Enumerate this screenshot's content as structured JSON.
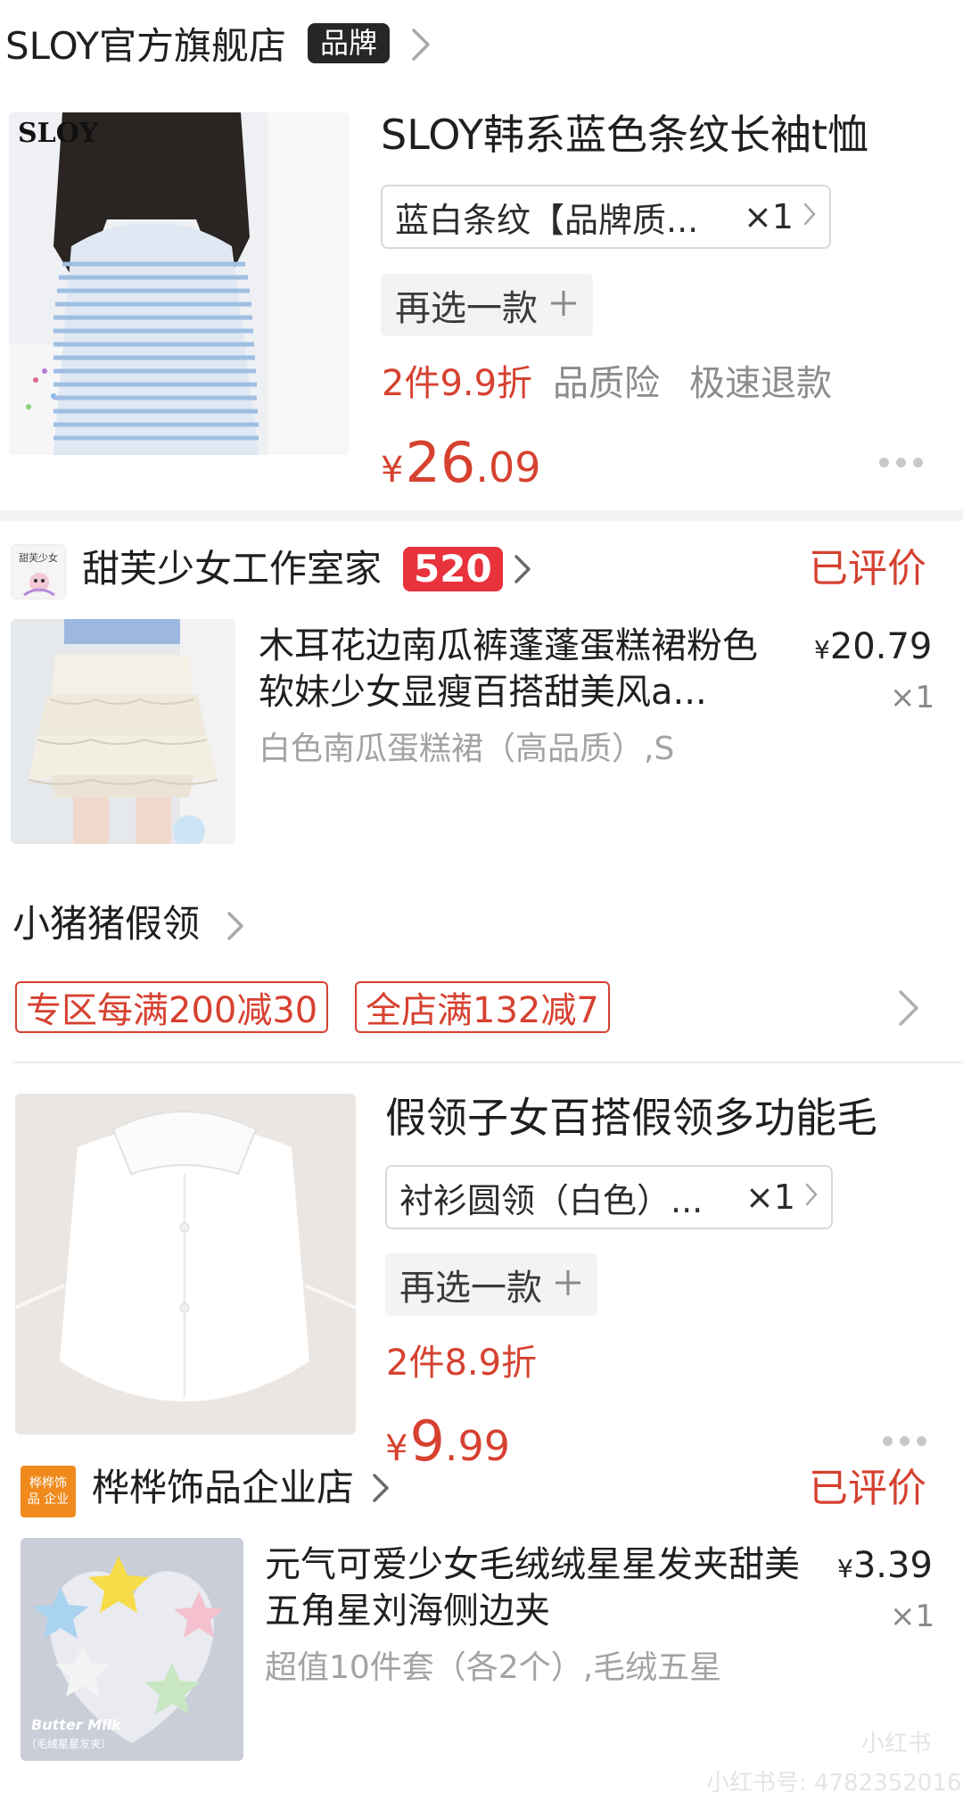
{
  "store1": {
    "name": "SLOY官方旗舰店",
    "tag": "品牌",
    "product": {
      "image_text": "SLOY",
      "title": "SLOY韩系蓝色条纹长袖t恤",
      "spec": "蓝白条纹【品牌质...",
      "qty": "×1",
      "reselect": "再选一款",
      "promos": [
        "2件9.9折",
        "品质险",
        "极速退款"
      ],
      "price_yen": "¥",
      "price_int": "26",
      "price_dec": ".09"
    }
  },
  "store2": {
    "logo_text": "甜芙少女",
    "name": "甜芙少女工作室家",
    "badge": "520",
    "status": "已评价",
    "product": {
      "title": "木耳花边南瓜裤蓬蓬蛋糕裙粉色软妹少女显瘦百搭甜美风a...",
      "spec": "白色南瓜蛋糕裙（高品质）,S",
      "price_yen": "¥",
      "price": "20.79",
      "qty": "×1"
    }
  },
  "store3": {
    "name": "小猪猪假领",
    "coupons": [
      "专区每满200减30",
      "全店满132减7"
    ],
    "product": {
      "title": "假领子女百搭假领多功能毛",
      "spec": "衬衫圆领（白色）...",
      "qty": "×1",
      "reselect": "再选一款",
      "promo": "2件8.9折",
      "price_yen": "¥",
      "price_int": "9",
      "price_dec": ".99"
    }
  },
  "store4": {
    "logo_text": "桦桦饰品 企业",
    "name": "桦桦饰品企业店",
    "status": "已评价",
    "product": {
      "image_text": "Butter Milk",
      "image_subtext": "（毛绒星星发夹）",
      "title": "元气可爱少女毛绒绒星星发夹甜美五角星刘海侧边夹",
      "spec": "超值10件套（各2个）,毛绒五星",
      "price_yen": "¥",
      "price": "3.39",
      "qty": "×1"
    }
  },
  "watermark": {
    "app": "小红书",
    "id": "小红书号: 4782352016"
  },
  "colors": {
    "accent_red": "#d64130",
    "badge_red": "#e8323c",
    "tag_dark": "#262626",
    "store4_logo": "#f08a1c"
  },
  "icons": [
    "chevron-right-icon",
    "plus-icon",
    "more-dots-icon"
  ]
}
